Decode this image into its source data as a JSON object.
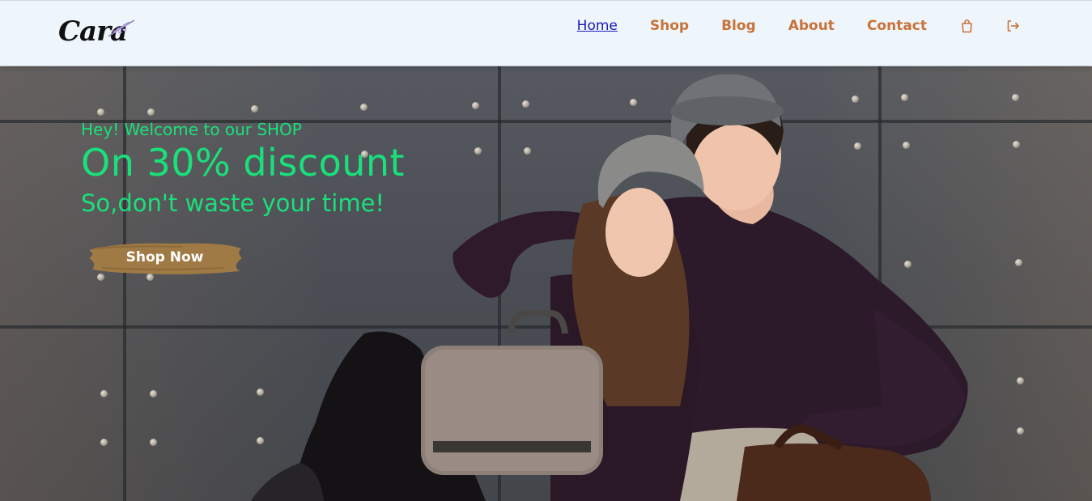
{
  "brand": {
    "logo_text": "Cara",
    "logo_alt": "Cara logo with lavender sprig"
  },
  "nav": {
    "items": [
      {
        "label": "Home",
        "active": true
      },
      {
        "label": "Shop",
        "active": false
      },
      {
        "label": "Blog",
        "active": false
      },
      {
        "label": "About",
        "active": false
      },
      {
        "label": "Contact",
        "active": false
      }
    ],
    "icons": [
      "shopping-bag-icon",
      "sign-out-icon"
    ]
  },
  "hero": {
    "eyebrow": "Hey! Welcome to our SHOP",
    "headline": "On 30% discount",
    "subline": "So,don't waste your time!",
    "cta_label": "Shop Now",
    "image_alt": "Young couple in beanies and sweaters with a handbag against a riveted metal wall"
  },
  "colors": {
    "accent_green": "#19e07a",
    "nav_link": "#c8733a",
    "nav_active": "#1a1ab8",
    "header_bg": "#eef5fb",
    "cta_brush": "#a07a45"
  }
}
